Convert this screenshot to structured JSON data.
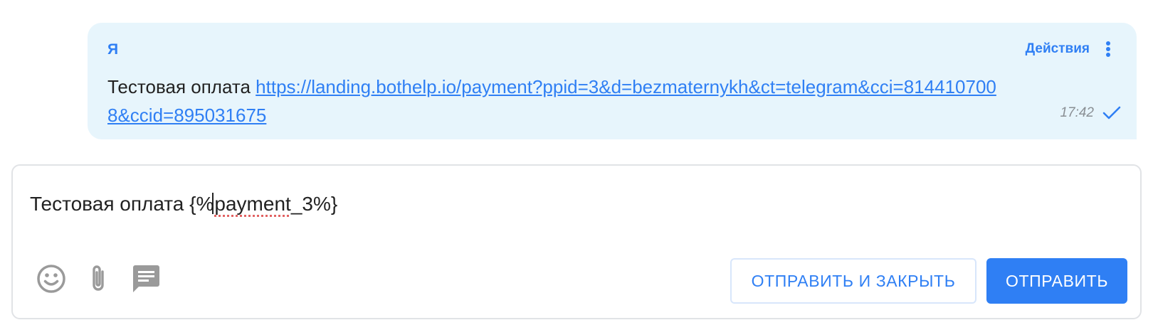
{
  "message": {
    "sender": "Я",
    "actions_label": "Действия",
    "text": "Тестовая оплата",
    "link": "https://landing.bothelp.io/payment?ppid=3&d=bezmaternykh&ct=telegram&cci=8144107008&ccid=895031675",
    "time": "17:42",
    "status_icon": "check-icon",
    "bubble_color": "#e7f5fc"
  },
  "composer": {
    "text_prefix": "Тестовая оплата {%",
    "text_spell": "payment",
    "text_suffix": "_3%}",
    "tools": {
      "emoji_icon": "emoji-icon",
      "attach_icon": "paperclip-icon",
      "templates_icon": "message-template-icon"
    },
    "send_close_label": "ОТПРАВИТЬ И ЗАКРЫТЬ",
    "send_label": "ОТПРАВИТЬ"
  },
  "colors": {
    "accent": "#2f7ff4",
    "icon_gray": "#9a9a9a"
  }
}
